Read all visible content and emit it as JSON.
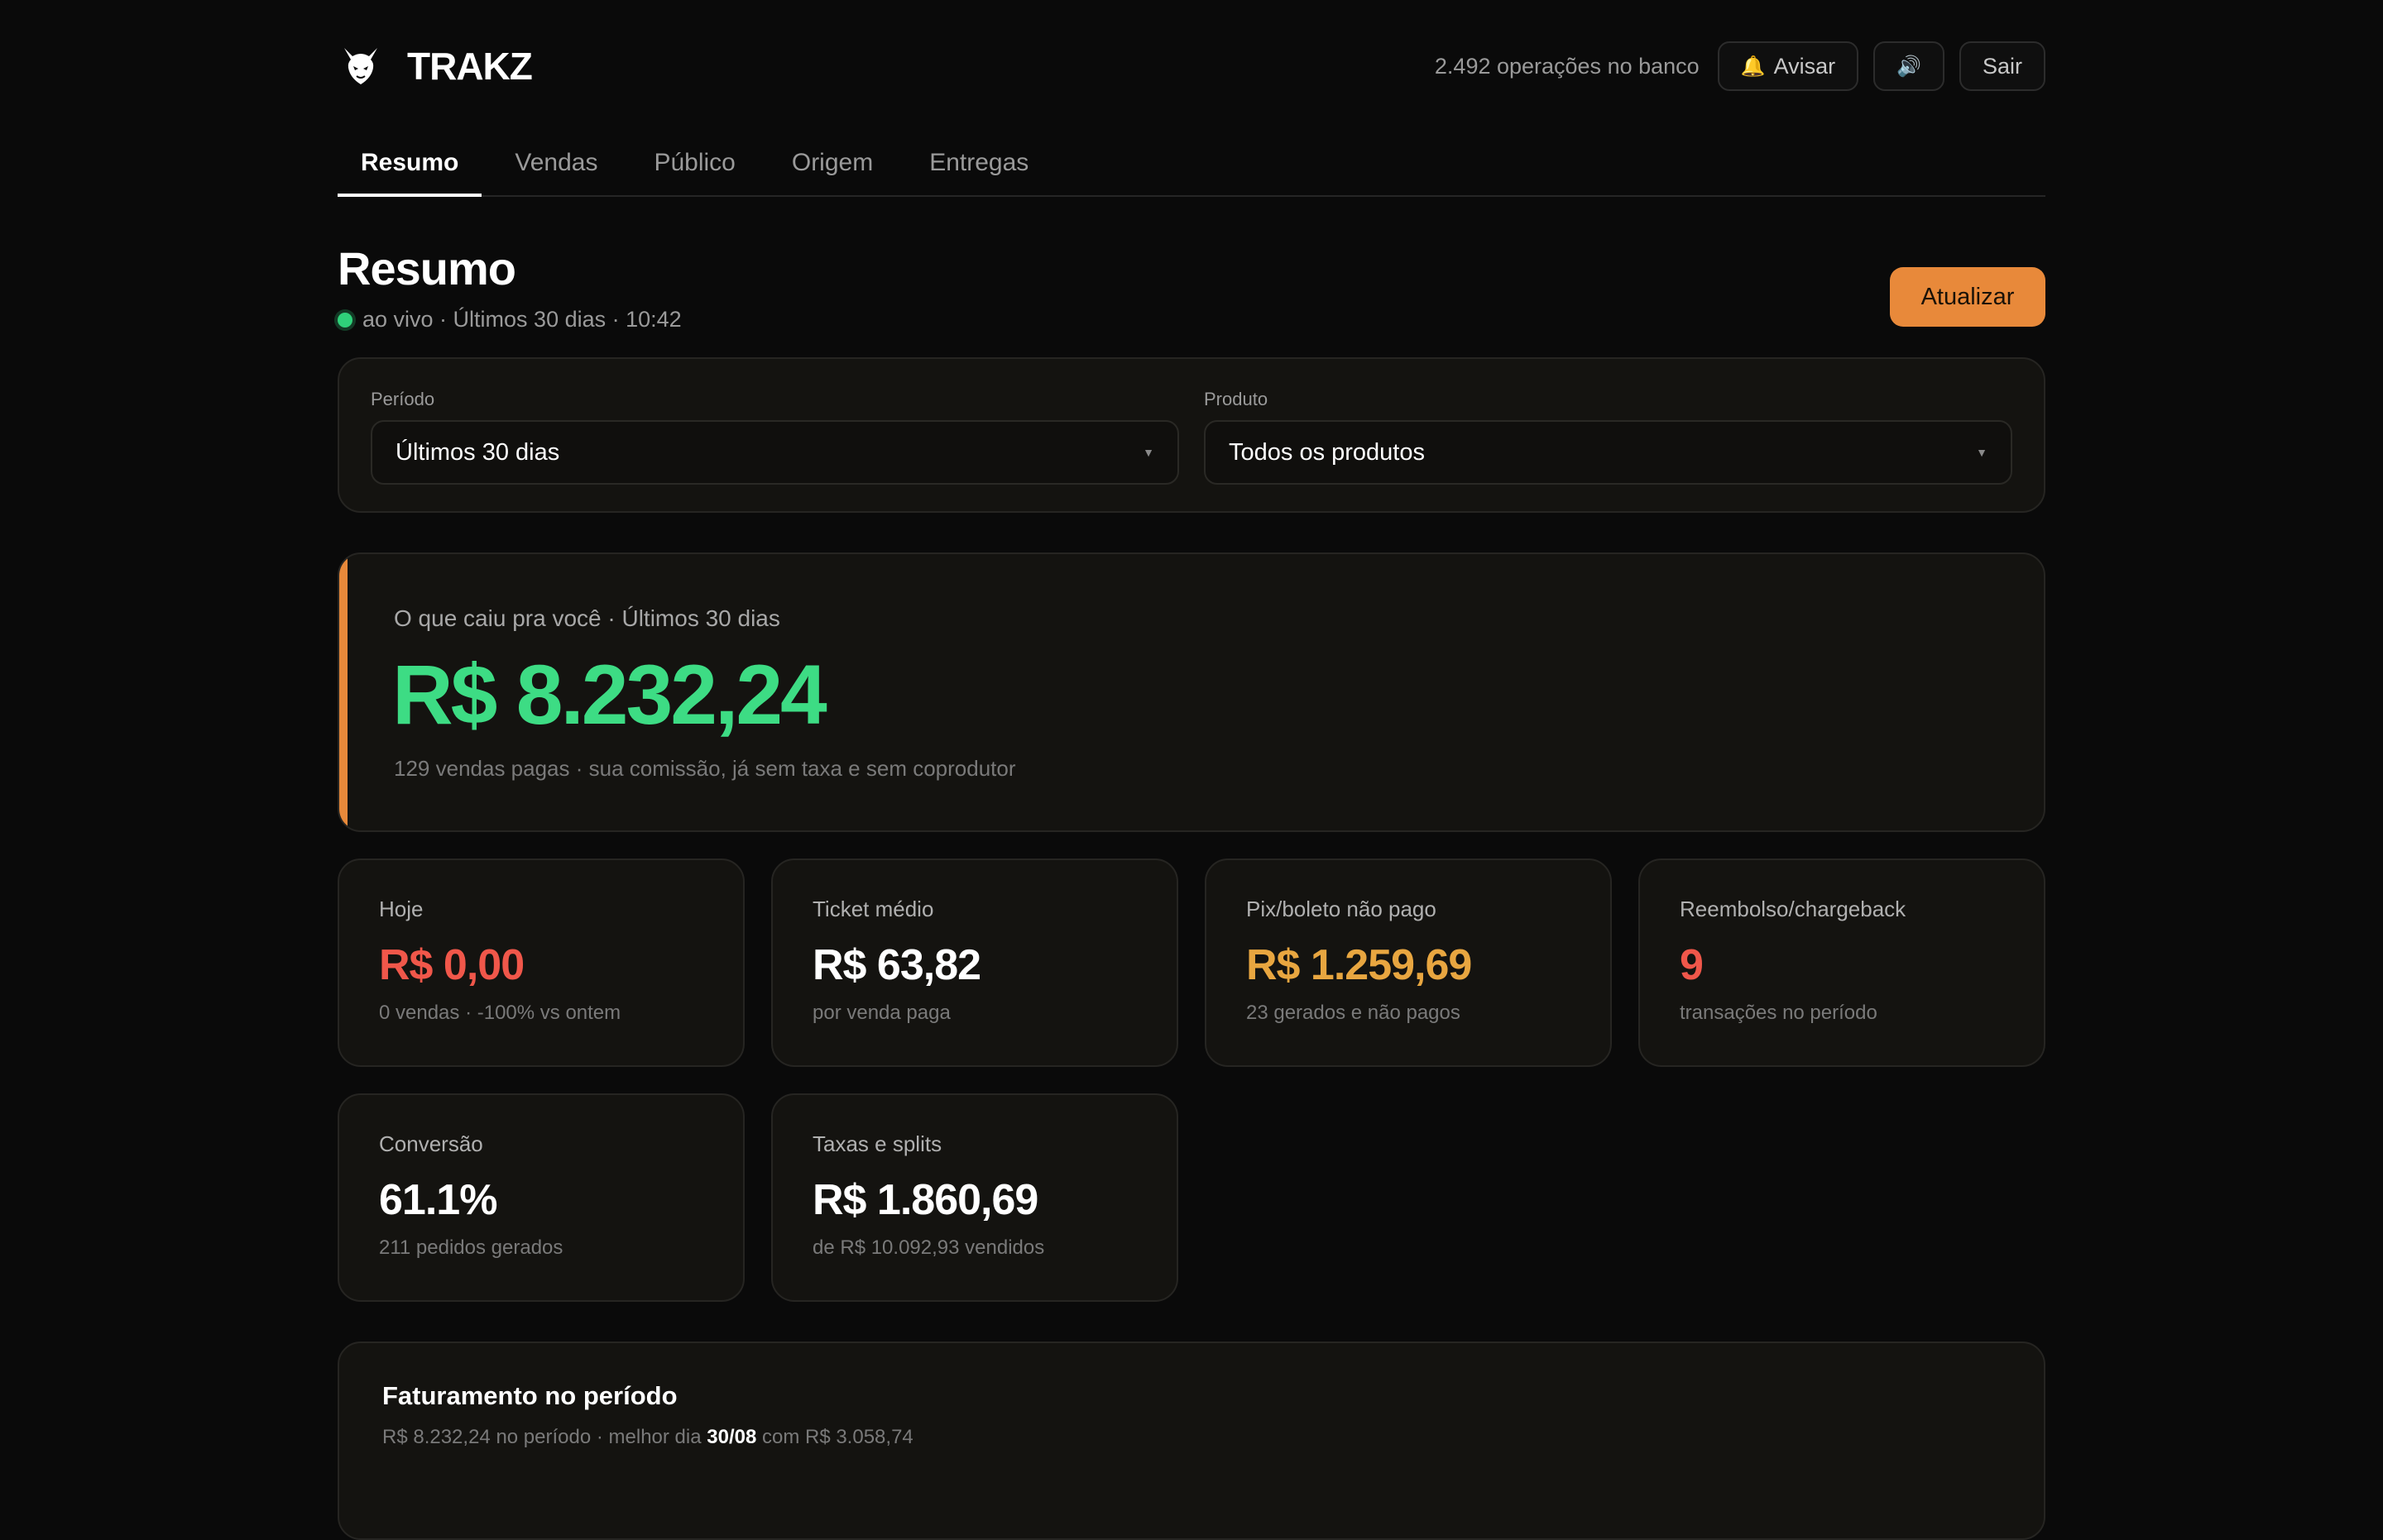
{
  "header": {
    "brand_name": "TRAKZ",
    "ops_count": "2.492 operações no banco",
    "notify_label": "Avisar",
    "notify_icon": "🔔",
    "sound_icon": "🔊",
    "logout_label": "Sair"
  },
  "tabs": [
    {
      "label": "Resumo",
      "active": true
    },
    {
      "label": "Vendas"
    },
    {
      "label": "Público"
    },
    {
      "label": "Origem"
    },
    {
      "label": "Entregas"
    }
  ],
  "page": {
    "title": "Resumo",
    "live_text": "ao vivo · Últimos 30 dias · 10:42",
    "refresh_label": "Atualizar"
  },
  "filters": {
    "period_label": "Período",
    "period_value": "Últimos 30 dias",
    "product_label": "Produto",
    "product_value": "Todos os produtos"
  },
  "hero": {
    "label": "O que caiu pra você · Últimos 30 dias",
    "value": "R$ 8.232,24",
    "sub": "129 vendas pagas · sua comissão, já sem taxa e sem coprodutor"
  },
  "stats": [
    {
      "label": "Hoje",
      "value": "R$ 0,00",
      "sub": "0 vendas · -100% vs ontem",
      "color": "#f0574a"
    },
    {
      "label": "Ticket médio",
      "value": "R$ 63,82",
      "sub": "por venda paga",
      "color": "#ffffff"
    },
    {
      "label": "Pix/boleto não pago",
      "value": "R$ 1.259,69",
      "sub": "23 gerados e não pagos",
      "color": "#e8a640"
    },
    {
      "label": "Reembolso/chargeback",
      "value": "9",
      "sub": "transações no período",
      "color": "#f0574a"
    },
    {
      "label": "Conversão",
      "value": "61.1%",
      "sub": "211 pedidos gerados",
      "color": "#ffffff"
    },
    {
      "label": "Taxas e splits",
      "value": "R$ 1.860,69",
      "sub": "de R$ 10.092,93 vendidos",
      "color": "#ffffff"
    }
  ],
  "revenue": {
    "title": "Faturamento no período",
    "sub_prefix": "R$ 8.232,24 no período · melhor dia ",
    "best_day": "30/08",
    "sub_suffix": " com R$ 3.058,74"
  },
  "colors": {
    "accent": "#e8893a",
    "positive": "#3ddc84",
    "negative": "#f0574a",
    "warning": "#e8a640"
  }
}
